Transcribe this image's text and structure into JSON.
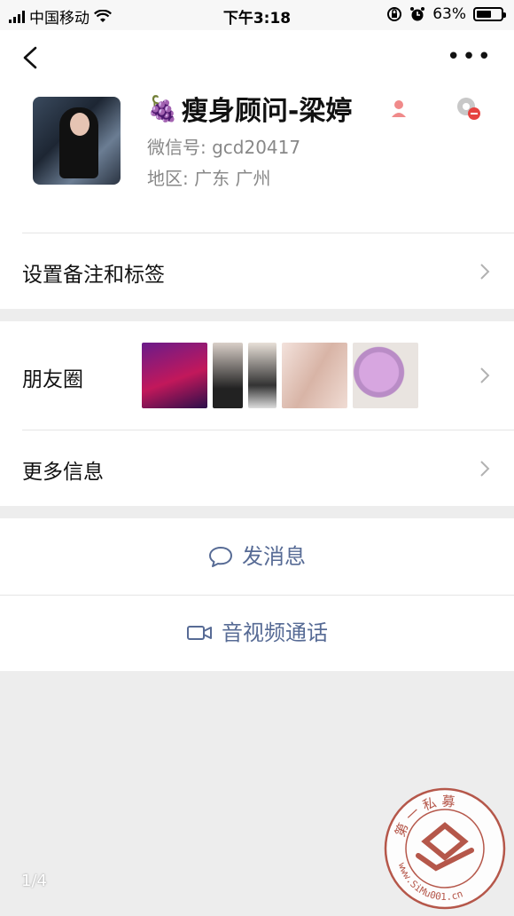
{
  "status_bar": {
    "carrier": "中国移动",
    "time": "下午3:18",
    "battery_percent": "63%",
    "battery_level": 0.63
  },
  "profile": {
    "name": "瘦身顾问-梁婷",
    "wechat_id": "微信号:  gcd20417",
    "region": "地区:  广东  广州"
  },
  "rows": {
    "remark": "设置备注和标签",
    "moments": "朋友圈",
    "more_info": "更多信息"
  },
  "actions": {
    "message": "发消息",
    "call": "音视频通话"
  },
  "page_indicator": "1/4",
  "watermark": {
    "top_text": "第 一 私 募",
    "bottom_text": "www.SiMu001.cn"
  },
  "colors": {
    "accent": "#576b95",
    "background": "#ededed"
  }
}
